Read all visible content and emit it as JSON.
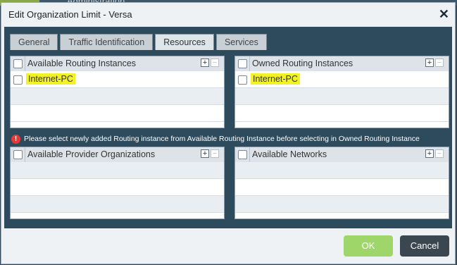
{
  "background": {
    "text": "Administration"
  },
  "dialog": {
    "title": "Edit Organization Limit - Versa",
    "close_glyph": "✕"
  },
  "tabs": [
    {
      "label": "General"
    },
    {
      "label": "Traffic Identification"
    },
    {
      "label": "Resources",
      "active": true
    },
    {
      "label": "Services"
    }
  ],
  "grids": {
    "available_routing": {
      "header": "Available Routing Instances",
      "rows": [
        "Internet-PC"
      ]
    },
    "owned_routing": {
      "header": "Owned Routing Instances",
      "rows": [
        "Internet-PC"
      ]
    },
    "available_provider_orgs": {
      "header": "Available Provider Organizations",
      "rows": []
    },
    "available_networks": {
      "header": "Available Networks",
      "rows": []
    }
  },
  "controls": {
    "plus": "+",
    "minus": "−"
  },
  "warning": {
    "icon": "!",
    "text": "Please select newly added Routing instance from Available Routing Instance before selecting in Owned Routing Instance"
  },
  "footer": {
    "ok_label": "OK",
    "cancel_label": "Cancel"
  },
  "colors": {
    "panel_bg": "#2e4b5e",
    "highlight": "#f2f226",
    "ok_button": "#9fd66a",
    "cancel_button": "#3a4650",
    "warning_icon": "#e53935"
  }
}
